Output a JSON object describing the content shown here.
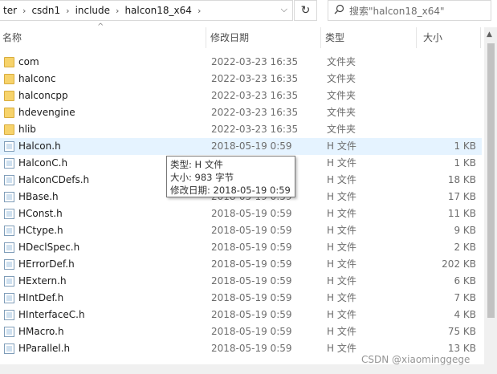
{
  "address": {
    "crumbs": [
      "ter",
      "csdn1",
      "include",
      "halcon18_x64"
    ],
    "dropdown": "⌵",
    "refresh": "↻"
  },
  "search": {
    "placeholder": "搜索\"halcon18_x64\""
  },
  "columns": {
    "name": "名称",
    "date": "修改日期",
    "type": "类型",
    "size": "大小"
  },
  "sort_indicator": "^",
  "rows": [
    {
      "name": "com",
      "date": "2022-03-23 16:35",
      "type": "文件夹",
      "size": "",
      "kind": "folder"
    },
    {
      "name": "halconc",
      "date": "2022-03-23 16:35",
      "type": "文件夹",
      "size": "",
      "kind": "folder"
    },
    {
      "name": "halconcpp",
      "date": "2022-03-23 16:35",
      "type": "文件夹",
      "size": "",
      "kind": "folder"
    },
    {
      "name": "hdevengine",
      "date": "2022-03-23 16:35",
      "type": "文件夹",
      "size": "",
      "kind": "folder"
    },
    {
      "name": "hlib",
      "date": "2022-03-23 16:35",
      "type": "文件夹",
      "size": "",
      "kind": "folder"
    },
    {
      "name": "Halcon.h",
      "date": "2018-05-19 0:59",
      "type": "H 文件",
      "size": "1 KB",
      "kind": "file",
      "selected": true
    },
    {
      "name": "HalconC.h",
      "date": "2018-05-19 0:59",
      "type": "H 文件",
      "size": "1 KB",
      "kind": "file"
    },
    {
      "name": "HalconCDefs.h",
      "date": "2018-05-19 0:59",
      "type": "H 文件",
      "size": "18 KB",
      "kind": "file"
    },
    {
      "name": "HBase.h",
      "date": "2018-05-19 0:59",
      "type": "H 文件",
      "size": "17 KB",
      "kind": "file"
    },
    {
      "name": "HConst.h",
      "date": "2018-05-19 0:59",
      "type": "H 文件",
      "size": "11 KB",
      "kind": "file"
    },
    {
      "name": "HCtype.h",
      "date": "2018-05-19 0:59",
      "type": "H 文件",
      "size": "9 KB",
      "kind": "file"
    },
    {
      "name": "HDeclSpec.h",
      "date": "2018-05-19 0:59",
      "type": "H 文件",
      "size": "2 KB",
      "kind": "file"
    },
    {
      "name": "HErrorDef.h",
      "date": "2018-05-19 0:59",
      "type": "H 文件",
      "size": "202 KB",
      "kind": "file"
    },
    {
      "name": "HExtern.h",
      "date": "2018-05-19 0:59",
      "type": "H 文件",
      "size": "6 KB",
      "kind": "file"
    },
    {
      "name": "HIntDef.h",
      "date": "2018-05-19 0:59",
      "type": "H 文件",
      "size": "7 KB",
      "kind": "file"
    },
    {
      "name": "HInterfaceC.h",
      "date": "2018-05-19 0:59",
      "type": "H 文件",
      "size": "4 KB",
      "kind": "file"
    },
    {
      "name": "HMacro.h",
      "date": "2018-05-19 0:59",
      "type": "H 文件",
      "size": "75 KB",
      "kind": "file"
    },
    {
      "name": "HParallel.h",
      "date": "2018-05-19 0:59",
      "type": "H 文件",
      "size": "13 KB",
      "kind": "file"
    }
  ],
  "tooltip": {
    "type_line": "类型: H 文件",
    "size_line": "大小: 983 字节",
    "date_line": "修改日期: 2018-05-19 0:59"
  },
  "watermark": "CSDN @xiaominggege"
}
